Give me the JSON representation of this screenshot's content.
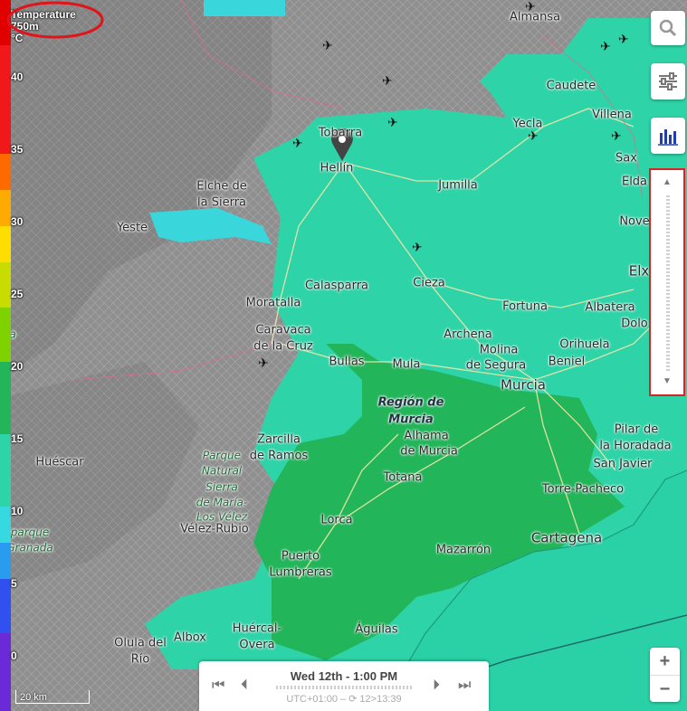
{
  "legend": {
    "title_line1": "Temperature",
    "title_line2": "750m",
    "unit": "°C",
    "ticks": [
      "40",
      "35",
      "30",
      "25",
      "20",
      "15",
      "10",
      "5",
      "0"
    ]
  },
  "cities": [
    {
      "name": "Almansa"
    },
    {
      "name": "Caudete"
    },
    {
      "name": "Villena"
    },
    {
      "name": "Yecla"
    },
    {
      "name": "Sax"
    },
    {
      "name": "Elda"
    },
    {
      "name": "Nove"
    },
    {
      "name": "Elx"
    },
    {
      "name": "Tobarra"
    },
    {
      "name": "Hellín"
    },
    {
      "name": "Elche de"
    },
    {
      "name": "la Sierra"
    },
    {
      "name": "Jumilla"
    },
    {
      "name": "Yeste"
    },
    {
      "name": "Calasparra"
    },
    {
      "name": "Cieza"
    },
    {
      "name": "Fortuna"
    },
    {
      "name": "Albatera"
    },
    {
      "name": "Dolo"
    },
    {
      "name": "Moratalla"
    },
    {
      "name": "Caravaca"
    },
    {
      "name": "de la Cruz"
    },
    {
      "name": "Archena"
    },
    {
      "name": "Molina"
    },
    {
      "name": "de Segura"
    },
    {
      "name": "Orihuela"
    },
    {
      "name": "Beniel"
    },
    {
      "name": "Bullas"
    },
    {
      "name": "Mula"
    },
    {
      "name": "Murcia"
    },
    {
      "name": "Región de"
    },
    {
      "name": "Murcia"
    },
    {
      "name": "Zarcilla"
    },
    {
      "name": "de Ramos"
    },
    {
      "name": "Alhama"
    },
    {
      "name": "de Murcia"
    },
    {
      "name": "Pilar de"
    },
    {
      "name": "la Horadada"
    },
    {
      "name": "Huéscar"
    },
    {
      "name": "San Javier"
    },
    {
      "name": "Totana"
    },
    {
      "name": "Torre-Pacheco"
    },
    {
      "name": "Parque"
    },
    {
      "name": "Natural"
    },
    {
      "name": "Sierra"
    },
    {
      "name": "de María-"
    },
    {
      "name": "Los Vélez"
    },
    {
      "name": "Vélez-Rubio"
    },
    {
      "name": "Lorca"
    },
    {
      "name": "Cartagena"
    },
    {
      "name": "parque"
    },
    {
      "name": "Granada"
    },
    {
      "name": "Puerto"
    },
    {
      "name": "Lumbreras"
    },
    {
      "name": "Mazarrón"
    },
    {
      "name": "Albox"
    },
    {
      "name": "Huércal-"
    },
    {
      "name": "Overa"
    },
    {
      "name": "Águilas"
    },
    {
      "name": "Olula del"
    },
    {
      "name": "Río"
    },
    {
      "name": "a"
    }
  ],
  "time": {
    "label": "Wed 12th - 1:00 PM",
    "sub": "UTC+01:00 – ⟳ 12>13:39"
  },
  "scale": "20 km",
  "controls": {
    "search_icon": "search-icon",
    "settings_icon": "sliders-icon",
    "chart_icon": "bar-chart-icon",
    "zoom_in": "+",
    "zoom_out": "−",
    "slider_up": "▲",
    "slider_down": "▼"
  },
  "colors": {
    "land_grey": "#8d8d8d",
    "temp_teal": "#2fd3a8",
    "temp_green": "#22b55a",
    "temp_cyan": "#36d9e0",
    "highlight_red": "#dd2222"
  }
}
